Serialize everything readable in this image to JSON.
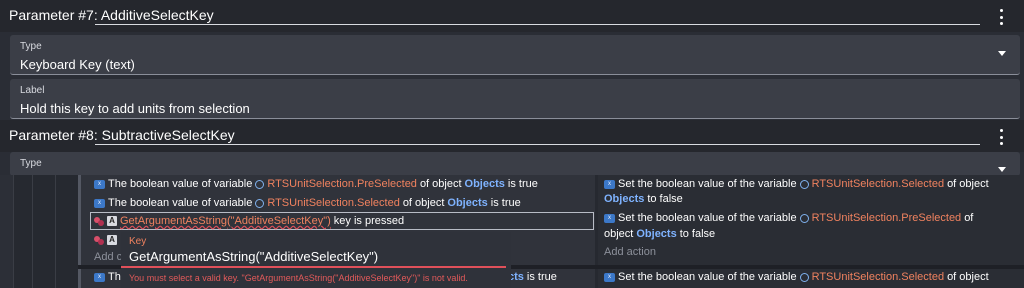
{
  "param7": {
    "prefix": "Parameter #7:",
    "name": "AdditiveSelectKey",
    "type_label": "Type",
    "type_value": "Keyboard Key (text)",
    "label_label": "Label",
    "label_value": "Hold this key to add units from selection"
  },
  "param8": {
    "prefix": "Parameter #8:",
    "name": "SubtractiveSelectKey",
    "type_label": "Type"
  },
  "conditions": {
    "c1": {
      "pre": "The boolean value of variable",
      "var": "RTSUnitSelection.PreSelected",
      "mid": "of object",
      "obj": "Objects",
      "post": "is true"
    },
    "c2": {
      "pre": "The boolean value of variable",
      "var": "RTSUnitSelection.Selected",
      "mid": "of object",
      "obj": "Objects",
      "post": "is true"
    },
    "c3": {
      "expr": "GetArgumentAsString(\"AdditiveSelectKey\")",
      "post": "key is pressed"
    },
    "add_partial": "Add c",
    "c5": {
      "pre": "The",
      "obj_partial": "cts",
      "post": "is true"
    }
  },
  "actions": {
    "a1": {
      "pre": "Set the boolean value of the variable",
      "var": "RTSUnitSelection.Selected",
      "mid": "of object",
      "obj": "Objects",
      "to": "to",
      "val": "false"
    },
    "a2": {
      "pre": "Set the boolean value of the variable",
      "var": "RTSUnitSelection.PreSelected",
      "mid": "of",
      "mid2": "object",
      "obj": "Objects",
      "to": "to",
      "val": "false"
    },
    "add_action": "Add action",
    "a3": {
      "pre": "Set the boolean value of the variable",
      "var": "RTSUnitSelection.Selected",
      "mid": "of object"
    }
  },
  "popover": {
    "label": "Key",
    "value": "GetArgumentAsString(\"AdditiveSelectKey\")",
    "error": "You must select a valid key. \"GetArgumentAsString(\"AdditiveSelectKey\")\" is not valid."
  },
  "colors": {
    "accent_orange": "#f0825f",
    "object_blue": "#7fb3ff",
    "error_red": "#e25a5a"
  }
}
